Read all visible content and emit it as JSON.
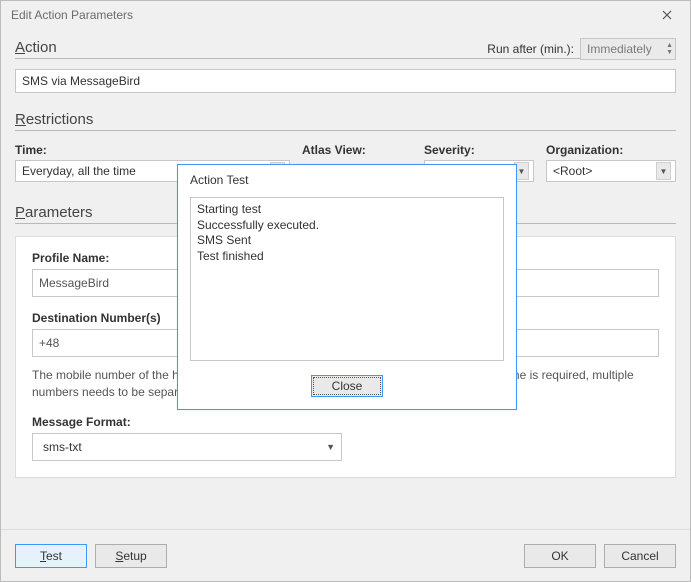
{
  "window": {
    "title": "Edit Action Parameters"
  },
  "action": {
    "heading": "Action",
    "run_after_label": "Run after (min.):",
    "run_after_value": "Immediately",
    "name": "SMS via MessageBird"
  },
  "restrictions": {
    "heading": "Restrictions",
    "time_label": "Time:",
    "time_value": "Everyday, all the time",
    "atlas_label": "Atlas View:",
    "severity_label": "Severity:",
    "organization_label": "Organization:",
    "organization_value": "<Root>"
  },
  "parameters": {
    "heading": "Parameters",
    "profile_label": "Profile Name:",
    "profile_value": "MessageBird",
    "dest_label": "Destination Number(s)",
    "dest_value": "+48",
    "dest_hint": "The mobile number of the handset to which the message must be delivered. If more than one is required, multiple numbers needs to be separated by comma.",
    "format_label": "Message Format:",
    "format_value": "sms-txt"
  },
  "footer": {
    "test": "Test",
    "setup": "Setup",
    "ok": "OK",
    "cancel": "Cancel"
  },
  "modal": {
    "title": "Action Test",
    "body": "Starting test\nSuccessfully executed.\nSMS Sent\nTest finished",
    "close": "Close"
  }
}
